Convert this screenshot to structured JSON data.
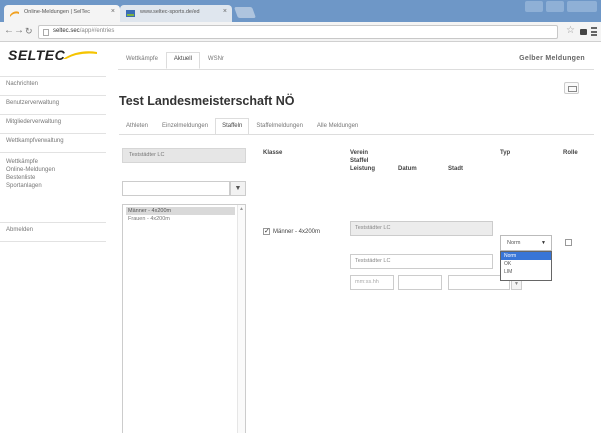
{
  "browser": {
    "tabs": [
      {
        "label": "Online-Meldungen | SelTec",
        "active": true
      },
      {
        "label": "www.seltec-sports.de/ed",
        "active": false
      }
    ],
    "url_host": "seltec.sec",
    "url_path": "/app#/entries"
  },
  "app": {
    "logo": "SELTEC",
    "top_nav": [
      "Wettkämpfe",
      "Aktuell",
      "WSNr"
    ],
    "active_top_nav": 1,
    "user": "Gelber Meldungen"
  },
  "sidebar": {
    "items": [
      "Nachrichten",
      "Benutzerverwaltung",
      "Mitgliederverwaltung",
      "Wettkampfverwaltung"
    ],
    "group": [
      "Wettkämpfe",
      "Online-Meldungen",
      "Bestenliste",
      "Sportanlagen"
    ],
    "last": "Abmelden"
  },
  "page": {
    "title": "Test Landesmeisterschaft NÖ",
    "sub_tabs": [
      "Athleten",
      "Einzelmeldungen",
      "Staffeln",
      "Staffelmeldungen",
      "Alle Meldungen"
    ],
    "active_sub_tab": 2
  },
  "left_panel": {
    "club": "Teststädter LC",
    "filter_button": "▼",
    "list_options": [
      "Männer - 4x200m",
      "Frauen - 4x200m"
    ],
    "selected_index": 0
  },
  "table": {
    "headers": {
      "klasse": "Klasse",
      "verein": "Verein",
      "staffel": "Staffel",
      "leistung": "Leistung",
      "datum": "Datum",
      "stadt": "Stadt",
      "typ": "Typ",
      "rolle": "Rolle"
    },
    "row": {
      "klasse": "Männer - 4x200m",
      "verein": "Teststädter LC",
      "staffel": "Teststädter LC",
      "leistung_placeholder": "mm:ss.hh",
      "typ_selected": "Norm",
      "typ_options": [
        "Norm",
        "OK",
        "LIM"
      ],
      "typ_highlight": 0,
      "checked": true
    }
  },
  "colors": {
    "tabstrip": "#6e97c7",
    "dropdown_highlight": "#3875d7"
  }
}
